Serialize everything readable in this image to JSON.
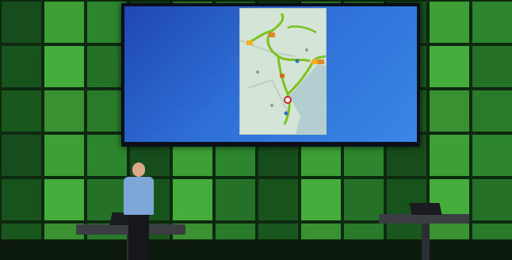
{
  "scene": {
    "description_tags": [
      "presenter-on-stage",
      "projection-screen",
      "green-tiled-wall",
      "podium",
      "laptop"
    ],
    "colors": {
      "wall_dark": "#1b5a20",
      "wall_mid": "#2f8a30",
      "wall_bright": "#48b43e",
      "screen_blue": "#2e6ed6",
      "map_background": "#d4e4d6",
      "route_line": "#7cc21e",
      "water": "#a9c8d0",
      "podium": "#3a3d42",
      "shirt": "#7ea6d6",
      "trousers": "#15171c"
    }
  }
}
